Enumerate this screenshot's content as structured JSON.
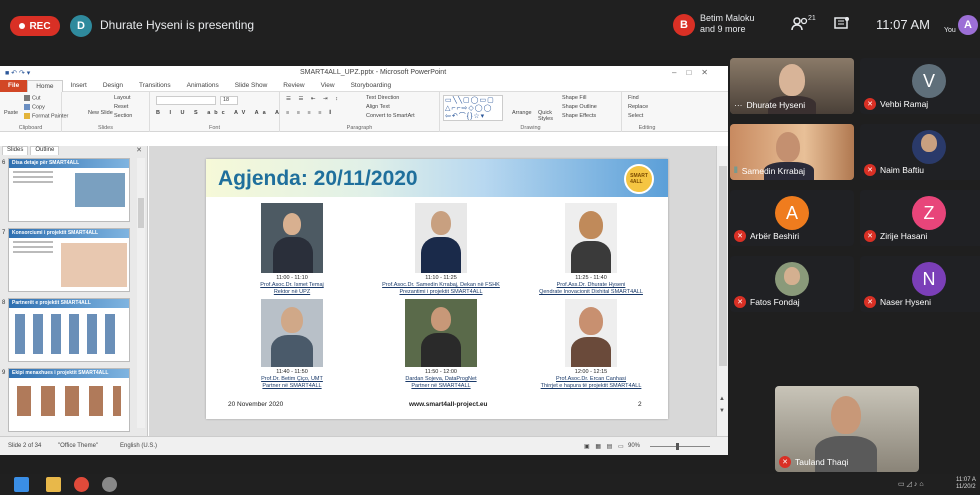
{
  "meet": {
    "rec_label": "REC",
    "presenter_initial": "D",
    "presenter_text": "Dhurate Hyseni is presenting",
    "host_initial": "B",
    "host_name_line1": "Betim Maloku",
    "host_name_line2": "and 9 more",
    "participants_count": "21",
    "clock": "11:07 AM",
    "you_label": "You",
    "self_initial": "A",
    "colors": {
      "rec": "#d93025",
      "presenter_avatar": "#2f8a9d",
      "self_avatar": "#9c6fd6"
    }
  },
  "ppt": {
    "window_title": "SMART4ALL_UPZ.pptx - Microsoft PowerPoint",
    "tabs": [
      "File",
      "Home",
      "Insert",
      "Design",
      "Transitions",
      "Animations",
      "Slide Show",
      "Review",
      "View",
      "Storyboarding"
    ],
    "ribbon": {
      "cut": "Cut",
      "copy": "Copy",
      "paste": "Paste",
      "format_painter": "Format Painter",
      "clipboard": "Clipboard",
      "layout": "Layout",
      "reset": "Reset",
      "new_slide": "New Slide",
      "section": "Section",
      "slides": "Slides",
      "font": "Font",
      "text_direction": "Text Direction",
      "align_text": "Align Text",
      "convert_smartart": "Convert to SmartArt",
      "paragraph": "Paragraph",
      "arrange": "Arrange",
      "quick_styles": "Quick Styles",
      "shape_fill": "Shape Fill",
      "shape_outline": "Shape Outline",
      "shape_effects": "Shape Effects",
      "drawing": "Drawing",
      "find": "Find",
      "replace": "Replace",
      "select": "Select",
      "editing": "Editing",
      "font_size": "18"
    },
    "pane_tabs": [
      "Slides",
      "Outline"
    ],
    "thumbnails": [
      {
        "num": "6",
        "title": "Disa detaje për SMART4ALL"
      },
      {
        "num": "7",
        "title": "Konsorciumi i projektit SMART4ALL"
      },
      {
        "num": "8",
        "title": "Partnerët e projektit SMART4ALL"
      },
      {
        "num": "9",
        "title": "Ekipi menaxhues i projektit SMART4ALL"
      }
    ],
    "slide": {
      "title": "Agjenda: 20/11/2020",
      "people": [
        {
          "time": "11:00 - 11:10",
          "name": "Prof.Asoc.Dr. Ismet Temaj",
          "role": "Rektor në UPZ"
        },
        {
          "time": "11:10 - 11:25",
          "name": "Prof.Asoc.Dr. Samedin Krrabaj, Dekan në FSHK",
          "role": "Prezantimi i projektit SMART4ALL"
        },
        {
          "time": "11:25 - 11:40",
          "name": "Prof.Ass.Dr. Dhurate Hyseni",
          "role": "Qendrate Inovacionit Dixhital SMART4ALL"
        },
        {
          "time": "11:40 - 11:50",
          "name": "Prof.Dr. Betim Çiço, UMT",
          "role": "Partner në SMART4ALL"
        },
        {
          "time": "11:50 - 12:00",
          "name": "Dardan Sojeva, DataProgNet",
          "role": "Partner në SMART4ALL"
        },
        {
          "time": "12:00 - 12:15",
          "name": "Prof.Asoc.Dr. Ercan Canhasi",
          "role": "Thirrjet e hapura të projektit SMART4ALL"
        }
      ],
      "footer_date": "20 November 2020",
      "footer_url": "www.smart4all-project.eu",
      "footer_page": "2"
    },
    "status": {
      "slide_of": "Slide 2 of 34",
      "theme": "\"Office Theme\"",
      "language": "English (U.S.)",
      "zoom": "90%"
    }
  },
  "tiles": [
    {
      "name": "Dhurate Hyseni",
      "initial": "",
      "color": "",
      "muted": false
    },
    {
      "name": "Vehbi Ramaj",
      "initial": "V",
      "color": "#5f6f7a",
      "muted": true
    },
    {
      "name": "Samedin Krrabaj",
      "initial": "",
      "color": "",
      "muted": false
    },
    {
      "name": "Naim Baftiu",
      "initial": "",
      "color": "",
      "muted": true
    },
    {
      "name": "Arbër Beshiri",
      "initial": "A",
      "color": "#ef7c1e",
      "muted": true
    },
    {
      "name": "Zirije Hasani",
      "initial": "Z",
      "color": "#e8457a",
      "muted": true
    },
    {
      "name": "Fatos Fondaj",
      "initial": "",
      "color": "",
      "muted": true
    },
    {
      "name": "Naser Hyseni",
      "initial": "N",
      "color": "#7b3fb8",
      "muted": true
    },
    {
      "name": "Tauland Thaqi",
      "initial": "",
      "color": "",
      "muted": true
    }
  ],
  "taskbar": {
    "time": "11:07 A",
    "date": "11/20/2"
  }
}
